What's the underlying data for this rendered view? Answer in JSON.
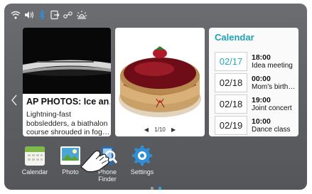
{
  "news_card": {
    "title": "AP PHOTOS: Ice an…",
    "body": "Lightning-fast bobsledders, a biathalon course shrouded in fog…"
  },
  "photo_card": {
    "pager": "1/10"
  },
  "calendar_card": {
    "title": "Calendar",
    "events": [
      {
        "date": "02/17",
        "time": "18:00",
        "title": "Idea meeting",
        "today": true
      },
      {
        "date": "02/18",
        "time": "00:00",
        "title": "Mom's birth…",
        "today": false
      },
      {
        "date": "02/18",
        "time": "19:00",
        "title": "Joint concert",
        "today": false
      },
      {
        "date": "02/19",
        "time": "10:00",
        "title": "Dance class",
        "today": false
      }
    ]
  },
  "apps": [
    {
      "label": "Calendar",
      "icon": "calendar-icon"
    },
    {
      "label": "Photo",
      "icon": "photo-icon"
    },
    {
      "label": "Phone\nFinder",
      "icon": "phone-finder-icon"
    },
    {
      "label": "Settings",
      "icon": "settings-icon"
    }
  ],
  "page_indicator": {
    "count": 2,
    "active": 1
  },
  "colors": {
    "accent": "#1fa2b5",
    "background": "#5c5e62"
  },
  "status_icons": [
    "wifi-icon",
    "volume-icon",
    "bluetooth-icon",
    "screen-mirror-icon",
    "network-icon",
    "brightness-icon"
  ]
}
